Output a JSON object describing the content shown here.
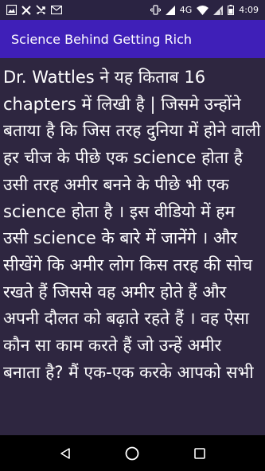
{
  "status_bar": {
    "time": "4:09",
    "network_label": "4G",
    "icons_left": [
      "image-notification-icon",
      "close-notification-icon",
      "missed-call-icon",
      "gmail-icon"
    ],
    "icons_right": [
      "vibrate-icon",
      "signal-icon",
      "wifi-icon",
      "cell-signal-icon",
      "battery-icon"
    ]
  },
  "app_bar": {
    "title": "Science Behind Getting Rich",
    "color": "#3f1fb8"
  },
  "content": {
    "text": "Dr. Wattles ने यह किताब  16 chapters में लिखी है | जिसमे उन्होंने बताया है कि जिस तरह दुनिया में होने वाली हर चीज के पीछे एक science होता है उसी तरह अमीर बनने के पीछे भी एक science होता है । इस वीडियो में हम उसी science के बारे में जानेंगे । और सीखेंगे कि अमीर लोग किस तरह की सोच रखते हैं  जिससे वह अमीर होते हैं और अपनी दौलत को बढ़ाते रहते हैं । वह ऐसा कौन सा काम करते हैं जो उन्हें अमीर बनाता है? मैं एक-एक करके आपको सभी",
    "background": "#2e2640"
  },
  "nav_bar": {
    "buttons": [
      "back-icon",
      "home-icon",
      "recents-icon"
    ]
  }
}
